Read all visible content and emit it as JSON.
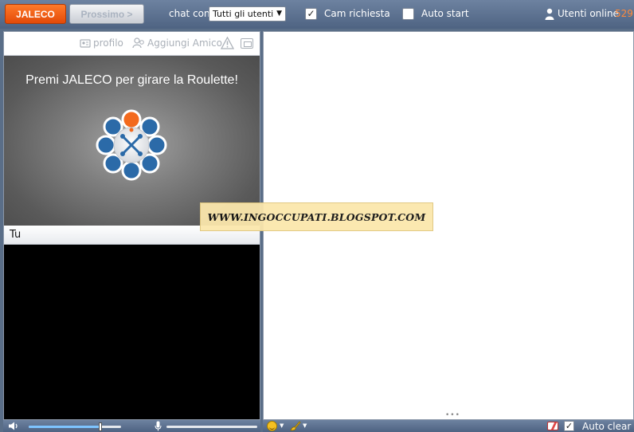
{
  "topbar": {
    "jaleco_label": "JALECO",
    "next_label": "Prossimo >",
    "chat_with_label": "chat con",
    "chat_with_value": "Tutti gli utenti",
    "cam_required_label": "Cam richiesta",
    "cam_required_checked": true,
    "auto_start_label": "Auto start",
    "auto_start_checked": false,
    "online_label": "Utenti online",
    "online_count": "529"
  },
  "stranger": {
    "toolbar": {
      "profile_label": "profilo",
      "add_friend_label": "Aggiungi Amico"
    },
    "roulette_message": "Premi JALECO per girare la Roulette!"
  },
  "self": {
    "label": "Tu"
  },
  "audio": {
    "volume_level": 0.78,
    "mic_level": 0
  },
  "chat": {
    "auto_clear_label": "Auto clear",
    "auto_clear_checked": true
  },
  "watermark": {
    "text": "WWW.INGOCCUPATI.BLOGSPOT.COM"
  },
  "colors": {
    "accent_orange": "#f05a14",
    "bar_blue": "#5a6e88",
    "online_count_color": "#ff8a3a",
    "logo_blue": "#2b6aa8",
    "logo_orange": "#f36a1e"
  }
}
